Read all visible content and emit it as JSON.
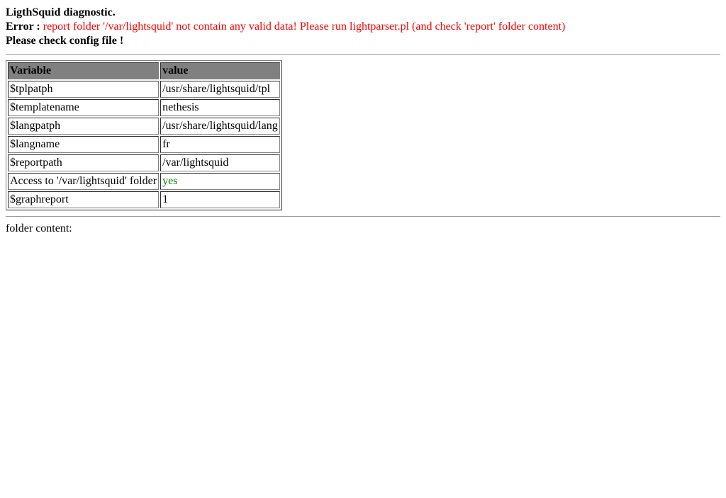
{
  "header": {
    "title": "LigthSquid diagnostic.",
    "error_label": "Error : ",
    "error_message": "report folder '/var/lightsquid' not contain any valid data! Please run lightparser.pl (and check 'report' folder content)",
    "check_config": "Please check config file !"
  },
  "table": {
    "columns": {
      "variable": "Variable",
      "value": "value"
    },
    "rows": [
      {
        "variable": "$tplpatph",
        "value": "/usr/share/lightsquid/tpl",
        "value_class": ""
      },
      {
        "variable": "$templatename",
        "value": "nethesis",
        "value_class": ""
      },
      {
        "variable": "$langpatph",
        "value": "/usr/share/lightsquid/lang",
        "value_class": ""
      },
      {
        "variable": "$langname",
        "value": "fr",
        "value_class": ""
      },
      {
        "variable": "$reportpath",
        "value": "/var/lightsquid",
        "value_class": ""
      },
      {
        "variable": "Access to '/var/lightsquid' folder",
        "value": "yes",
        "value_class": "yes"
      },
      {
        "variable": "$graphreport",
        "value": "1",
        "value_class": ""
      }
    ]
  },
  "folder_content_label": "folder content:"
}
